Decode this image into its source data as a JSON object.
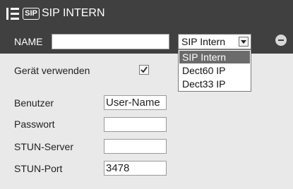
{
  "title": {
    "badge": "SIP",
    "text": "SIP INTERN"
  },
  "name_row": {
    "label": "NAME",
    "input_value": "",
    "select_value": "SIP Intern",
    "options": [
      "SIP Intern",
      "Dect60 IP",
      "Dect33 IP"
    ]
  },
  "fields": {
    "use_device_label": "Gerät verwenden",
    "use_device_checked": true,
    "user_label": "Benutzer",
    "user_value": "User-Name",
    "password_label": "Passwort",
    "password_value": "",
    "stun_server_label": "STUN-Server",
    "stun_server_value": "",
    "stun_port_label": "STUN-Port",
    "stun_port_value": "3478"
  }
}
